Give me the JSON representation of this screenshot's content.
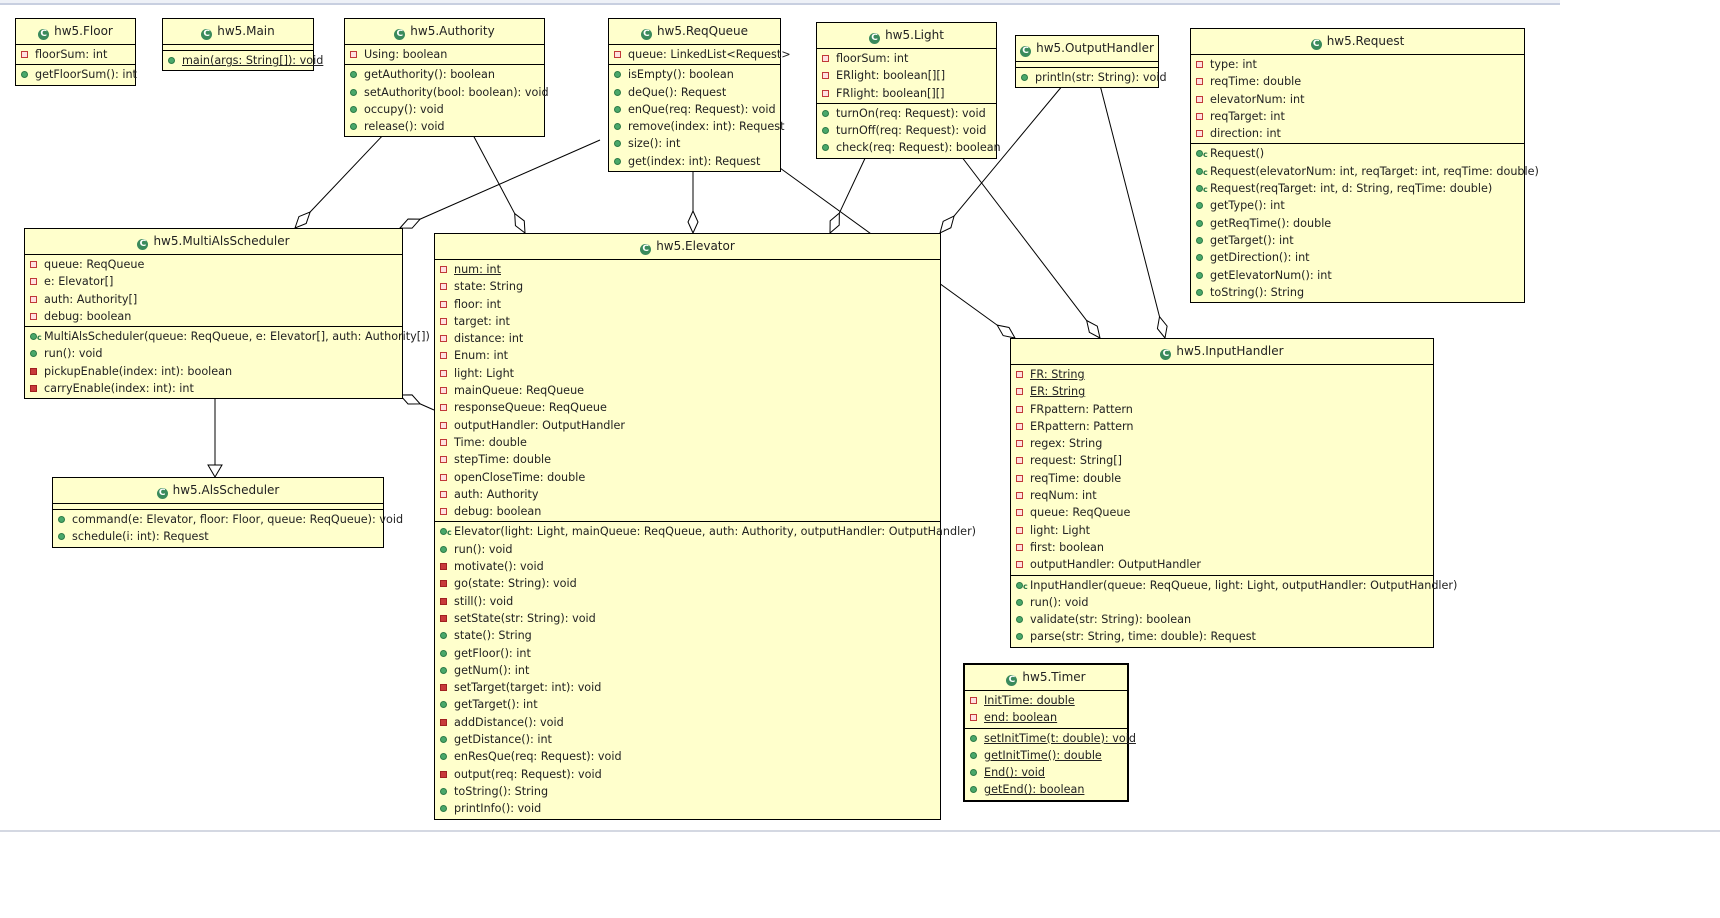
{
  "diagram": {
    "classes": [
      {
        "id": "floor",
        "name": "hw5.Floor",
        "attributes": [
          {
            "text": "floorSum: int",
            "vis": "private"
          }
        ],
        "methods": [
          {
            "text": "getFloorSum(): int",
            "vis": "public"
          }
        ]
      },
      {
        "id": "main",
        "name": "hw5.Main",
        "attributes": [],
        "methods": [
          {
            "text": "main(args: String[]): void",
            "vis": "public",
            "static": true
          }
        ]
      },
      {
        "id": "authority",
        "name": "hw5.Authority",
        "attributes": [
          {
            "text": "Using: boolean",
            "vis": "private"
          }
        ],
        "methods": [
          {
            "text": "getAuthority(): boolean",
            "vis": "public"
          },
          {
            "text": "setAuthority(bool: boolean): void",
            "vis": "public"
          },
          {
            "text": "occupy(): void",
            "vis": "public"
          },
          {
            "text": "release(): void",
            "vis": "public"
          }
        ]
      },
      {
        "id": "reqqueue",
        "name": "hw5.ReqQueue",
        "attributes": [
          {
            "text": "queue: LinkedList<Request>",
            "vis": "private"
          }
        ],
        "methods": [
          {
            "text": "isEmpty(): boolean",
            "vis": "public"
          },
          {
            "text": "deQue(): Request",
            "vis": "public"
          },
          {
            "text": "enQue(req: Request): void",
            "vis": "public"
          },
          {
            "text": "remove(index: int): Request",
            "vis": "public"
          },
          {
            "text": "size(): int",
            "vis": "public"
          },
          {
            "text": "get(index: int): Request",
            "vis": "public"
          }
        ]
      },
      {
        "id": "light",
        "name": "hw5.Light",
        "attributes": [
          {
            "text": "floorSum: int",
            "vis": "private"
          },
          {
            "text": "ERlight: boolean[][]",
            "vis": "private"
          },
          {
            "text": "FRlight: boolean[][]",
            "vis": "private"
          }
        ],
        "methods": [
          {
            "text": "turnOn(req: Request): void",
            "vis": "public"
          },
          {
            "text": "turnOff(req: Request): void",
            "vis": "public"
          },
          {
            "text": "check(req: Request): boolean",
            "vis": "public"
          }
        ]
      },
      {
        "id": "outputhandler",
        "name": "hw5.OutputHandler",
        "attributes": [],
        "methods": [
          {
            "text": "println(str: String): void",
            "vis": "public"
          }
        ]
      },
      {
        "id": "request",
        "name": "hw5.Request",
        "attributes": [
          {
            "text": "type: int",
            "vis": "private"
          },
          {
            "text": "reqTime: double",
            "vis": "private"
          },
          {
            "text": "elevatorNum: int",
            "vis": "private"
          },
          {
            "text": "reqTarget: int",
            "vis": "private"
          },
          {
            "text": "direction: int",
            "vis": "private"
          }
        ],
        "methods": [
          {
            "text": "Request()",
            "vis": "constructor"
          },
          {
            "text": "Request(elevatorNum: int, reqTarget: int, reqTime: double)",
            "vis": "constructor"
          },
          {
            "text": "Request(reqTarget: int, d: String, reqTime: double)",
            "vis": "constructor"
          },
          {
            "text": "getType(): int",
            "vis": "public"
          },
          {
            "text": "getReqTime(): double",
            "vis": "public"
          },
          {
            "text": "getTarget(): int",
            "vis": "public"
          },
          {
            "text": "getDirection(): int",
            "vis": "public"
          },
          {
            "text": "getElevatorNum(): int",
            "vis": "public"
          },
          {
            "text": "toString(): String",
            "vis": "public"
          }
        ]
      },
      {
        "id": "multials",
        "name": "hw5.MultiAlsScheduler",
        "attributes": [
          {
            "text": "queue: ReqQueue",
            "vis": "private"
          },
          {
            "text": "e: Elevator[]",
            "vis": "private"
          },
          {
            "text": "auth: Authority[]",
            "vis": "private"
          },
          {
            "text": "debug: boolean",
            "vis": "private"
          }
        ],
        "methods": [
          {
            "text": "MultiAlsScheduler(queue: ReqQueue, e: Elevator[], auth: Authority[])",
            "vis": "constructor"
          },
          {
            "text": "run(): void",
            "vis": "public"
          },
          {
            "text": "pickupEnable(index: int): boolean",
            "vis": "privmethod"
          },
          {
            "text": "carryEnable(index: int): int",
            "vis": "privmethod"
          }
        ]
      },
      {
        "id": "elevator",
        "name": "hw5.Elevator",
        "attributes": [
          {
            "text": "num: int",
            "vis": "private",
            "static": true
          },
          {
            "text": "state: String",
            "vis": "private"
          },
          {
            "text": "floor: int",
            "vis": "private"
          },
          {
            "text": "target: int",
            "vis": "private"
          },
          {
            "text": "distance: int",
            "vis": "private"
          },
          {
            "text": "Enum: int",
            "vis": "private"
          },
          {
            "text": "light: Light",
            "vis": "private"
          },
          {
            "text": "mainQueue: ReqQueue",
            "vis": "private"
          },
          {
            "text": "responseQueue: ReqQueue",
            "vis": "private"
          },
          {
            "text": "outputHandler: OutputHandler",
            "vis": "private"
          },
          {
            "text": "Time: double",
            "vis": "private"
          },
          {
            "text": "stepTime: double",
            "vis": "private"
          },
          {
            "text": "openCloseTime: double",
            "vis": "private"
          },
          {
            "text": "auth: Authority",
            "vis": "private"
          },
          {
            "text": "debug: boolean",
            "vis": "private"
          }
        ],
        "methods": [
          {
            "text": "Elevator(light: Light, mainQueue: ReqQueue, auth: Authority, outputHandler: OutputHandler)",
            "vis": "constructor"
          },
          {
            "text": "run(): void",
            "vis": "public"
          },
          {
            "text": "motivate(): void",
            "vis": "privmethod"
          },
          {
            "text": "go(state: String): void",
            "vis": "privmethod"
          },
          {
            "text": "still(): void",
            "vis": "privmethod"
          },
          {
            "text": "setState(str: String): void",
            "vis": "privmethod"
          },
          {
            "text": "state(): String",
            "vis": "public"
          },
          {
            "text": "getFloor(): int",
            "vis": "public"
          },
          {
            "text": "getNum(): int",
            "vis": "public"
          },
          {
            "text": "setTarget(target: int): void",
            "vis": "privmethod"
          },
          {
            "text": "getTarget(): int",
            "vis": "public"
          },
          {
            "text": "addDistance(): void",
            "vis": "privmethod"
          },
          {
            "text": "getDistance(): int",
            "vis": "public"
          },
          {
            "text": "enResQue(req: Request): void",
            "vis": "public"
          },
          {
            "text": "output(req: Request): void",
            "vis": "privmethod"
          },
          {
            "text": "toString(): String",
            "vis": "public"
          },
          {
            "text": "printInfo(): void",
            "vis": "public"
          }
        ]
      },
      {
        "id": "alsscheduler",
        "name": "hw5.AlsScheduler",
        "attributes": [],
        "methods": [
          {
            "text": "command(e: Elevator, floor: Floor, queue: ReqQueue): void",
            "vis": "public"
          },
          {
            "text": "schedule(i: int): Request",
            "vis": "public"
          }
        ]
      },
      {
        "id": "inputhandler",
        "name": "hw5.InputHandler",
        "attributes": [
          {
            "text": "FR: String",
            "vis": "private",
            "static": true
          },
          {
            "text": "ER: String",
            "vis": "private",
            "static": true
          },
          {
            "text": "FRpattern: Pattern",
            "vis": "private"
          },
          {
            "text": "ERpattern: Pattern",
            "vis": "private"
          },
          {
            "text": "regex: String",
            "vis": "private"
          },
          {
            "text": "request: String[]",
            "vis": "private"
          },
          {
            "text": "reqTime: double",
            "vis": "private"
          },
          {
            "text": "reqNum: int",
            "vis": "private"
          },
          {
            "text": "queue: ReqQueue",
            "vis": "private"
          },
          {
            "text": "light: Light",
            "vis": "private"
          },
          {
            "text": "first: boolean",
            "vis": "private"
          },
          {
            "text": "outputHandler: OutputHandler",
            "vis": "private"
          }
        ],
        "methods": [
          {
            "text": "InputHandler(queue: ReqQueue, light: Light, outputHandler: OutputHandler)",
            "vis": "constructor"
          },
          {
            "text": "run(): void",
            "vis": "public"
          },
          {
            "text": "validate(str: String): boolean",
            "vis": "public"
          },
          {
            "text": "parse(str: String, time: double): Request",
            "vis": "public"
          }
        ]
      },
      {
        "id": "timer",
        "name": "hw5.Timer",
        "selected": true,
        "attributes": [
          {
            "text": "InitTime: double",
            "vis": "private",
            "static": true
          },
          {
            "text": "end: boolean",
            "vis": "private",
            "static": true
          }
        ],
        "methods": [
          {
            "text": "setInitTime(t: double): void",
            "vis": "public",
            "static": true
          },
          {
            "text": "getInitTime(): double",
            "vis": "public",
            "static": true
          },
          {
            "text": "End(): void",
            "vis": "public",
            "static": true
          },
          {
            "text": "getEnd(): boolean",
            "vis": "public",
            "static": true
          }
        ]
      }
    ],
    "relations": [
      {
        "type": "aggregation",
        "from": "authority",
        "to": "multials"
      },
      {
        "type": "aggregation",
        "from": "authority",
        "to": "elevator"
      },
      {
        "type": "aggregation",
        "from": "reqqueue",
        "to": "multials"
      },
      {
        "type": "aggregation",
        "from": "reqqueue",
        "to": "elevator"
      },
      {
        "type": "aggregation",
        "from": "reqqueue",
        "to": "inputhandler"
      },
      {
        "type": "aggregation",
        "from": "light",
        "to": "elevator"
      },
      {
        "type": "aggregation",
        "from": "light",
        "to": "inputhandler"
      },
      {
        "type": "aggregation",
        "from": "outputhandler",
        "to": "elevator"
      },
      {
        "type": "aggregation",
        "from": "outputhandler",
        "to": "inputhandler"
      },
      {
        "type": "aggregation",
        "from": "elevator",
        "to": "multials"
      },
      {
        "type": "generalization",
        "from": "multials",
        "to": "alsscheduler"
      }
    ],
    "colors": {
      "class_fill": "#ffffcc",
      "class_icon": "#3a8a5c",
      "private": "#c03838",
      "public": "#4aa86a"
    }
  }
}
